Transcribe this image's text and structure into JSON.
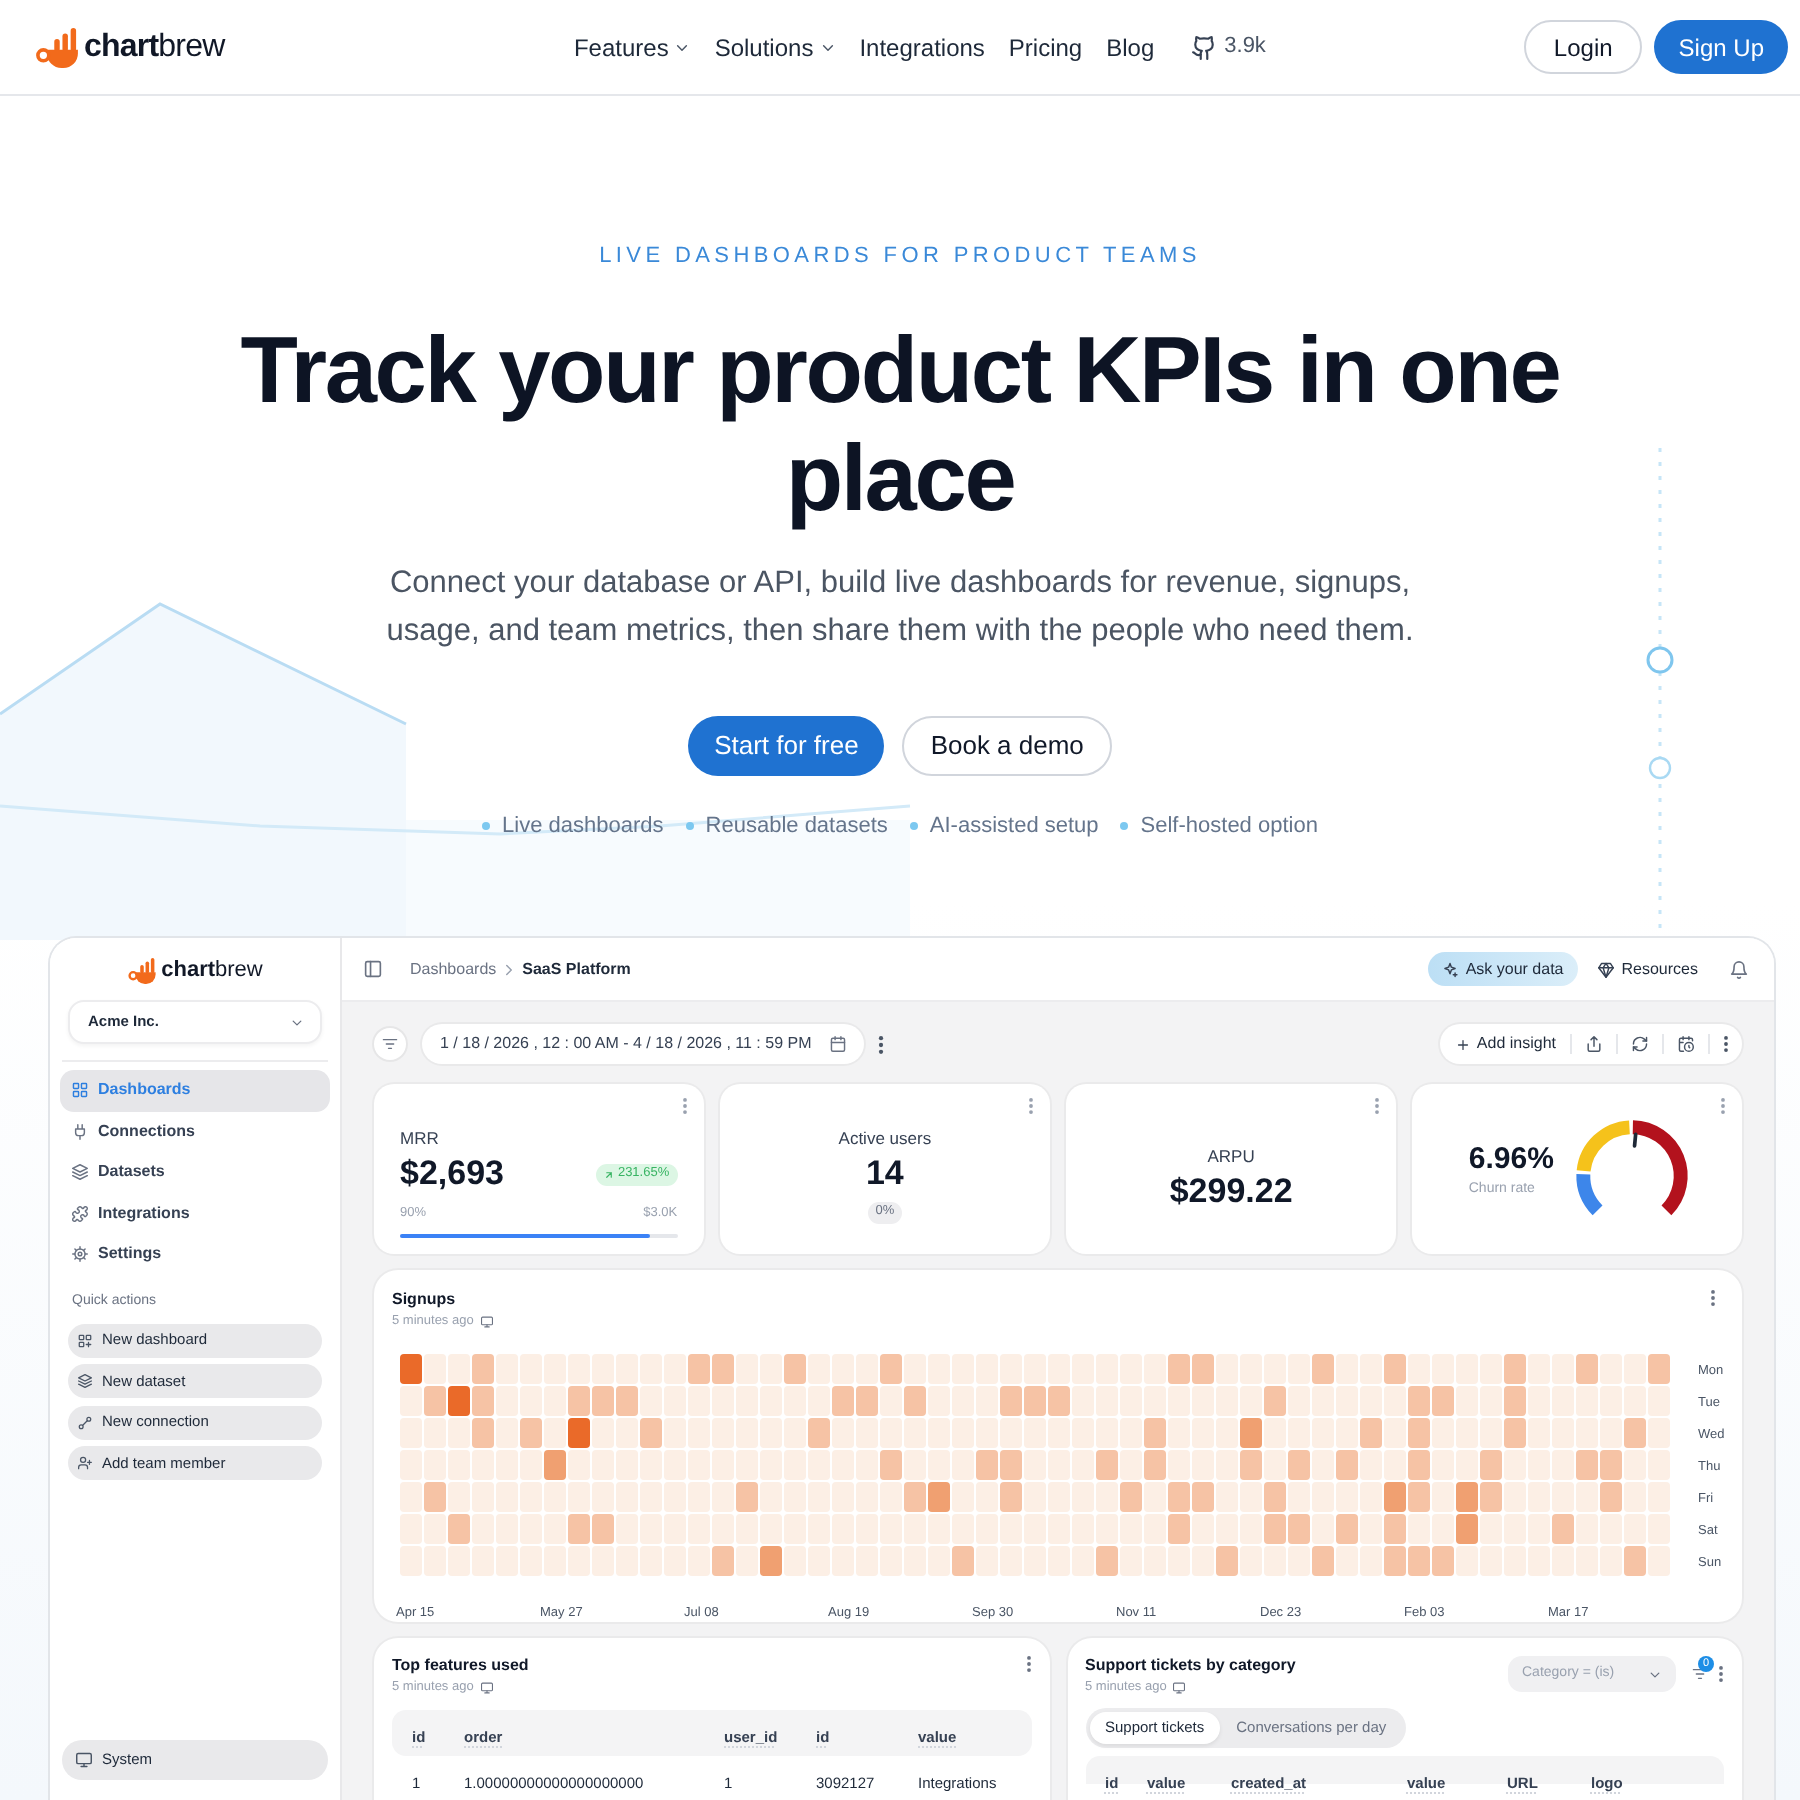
{
  "header": {
    "logo": "**chart**brew",
    "nav": [
      {
        "label": "Features",
        "dropdown": true
      },
      {
        "label": "Solutions",
        "dropdown": true
      },
      {
        "label": "Integrations",
        "dropdown": false
      },
      {
        "label": "Pricing",
        "dropdown": false
      },
      {
        "label": "Blog",
        "dropdown": false
      }
    ],
    "github_stars": "3.9k",
    "buttons": [
      {
        "label": "Login",
        "kind": "outline"
      },
      {
        "label": "Sign Up",
        "kind": "primary"
      }
    ]
  },
  "hero": {
    "eyebrow": "LIVE DASHBOARDS FOR PRODUCT TEAMS",
    "title": "Track your product KPIs in one place",
    "subtitle": "Connect your database or API, build live dashboards for revenue, signups, usage, and team metrics, then share them with the people who need them.",
    "buttons": [
      {
        "label": "Start for free",
        "kind": "primary"
      },
      {
        "label": "Book a demo",
        "kind": "outline"
      }
    ],
    "highlights": [
      "Live dashboards",
      "Reusable datasets",
      "AI-assisted setup",
      "Self-hosted option"
    ]
  },
  "dashboard": {
    "sidebar": {
      "logo": "**chart**brew",
      "team": "Acme Inc.",
      "items": [
        {
          "label": "Dashboards",
          "selected": true
        },
        {
          "label": "Connections",
          "selected": false
        },
        {
          "label": "Datasets",
          "selected": false
        },
        {
          "label": "Integrations",
          "selected": false
        },
        {
          "label": "Settings",
          "selected": false
        }
      ],
      "quick_actions_title": "Quick actions",
      "quick_actions": [
        "New dashboard",
        "New dataset",
        "New connection",
        "Add team member"
      ],
      "footer_button": "System"
    },
    "breadcrumb": [
      "Dashboards",
      "SaaS Platform"
    ],
    "top_actions": [
      {
        "label": "Ask your data",
        "highlighted": true
      },
      {
        "label": "Resources",
        "highlighted": false
      }
    ],
    "date_range": "1 / 18 / 2026 , 12 : 00 AM - 4 / 18 / 2026 , 11 : 59 PM",
    "add_insight": "Add insight",
    "kpis": [
      {
        "kind": "progress",
        "title": "MRR",
        "value": "$2,693",
        "change": "231.65%",
        "positive": true,
        "min_label": "90%",
        "max_label": "$3.0K",
        "level": 0.9
      },
      {
        "kind": "number",
        "title": "Active users",
        "value": "14",
        "change": "0%",
        "positive": false
      },
      {
        "kind": "number",
        "title": "ARPU",
        "value": "$299.22"
      },
      {
        "kind": "gauge",
        "title": "Churn rate",
        "value": "6.96%"
      }
    ],
    "heatmap": {
      "title": "Signups",
      "updated": "5 minutes ago",
      "days": [
        "Mon",
        "Tue",
        "Wed",
        "Thu",
        "Fri",
        "Sat",
        "Sun"
      ],
      "months": [
        "Apr 15",
        "May 27",
        "Jul 08",
        "Aug 19",
        "Sep 30",
        "Nov 11",
        "Dec 23",
        "Feb 03",
        "Mar 17"
      ]
    },
    "tables": [
      {
        "title": "Top features used",
        "updated": "5 minutes ago",
        "columns": [
          "id",
          "order",
          "user_id",
          "id",
          "value"
        ],
        "rows": [
          [
            "1",
            "1.00000000000000000000",
            "1",
            "3092127",
            "Integrations"
          ]
        ]
      },
      {
        "title": "Support tickets by category",
        "updated": "5 minutes ago",
        "filter": "Category = (is)",
        "filter_count": "0",
        "tabs": [
          {
            "label": "Support tickets",
            "selected": true
          },
          {
            "label": "Conversations per day",
            "selected": false
          }
        ],
        "columns": [
          "id",
          "value",
          "created_at",
          "value",
          "URL",
          "logo"
        ]
      }
    ]
  }
}
